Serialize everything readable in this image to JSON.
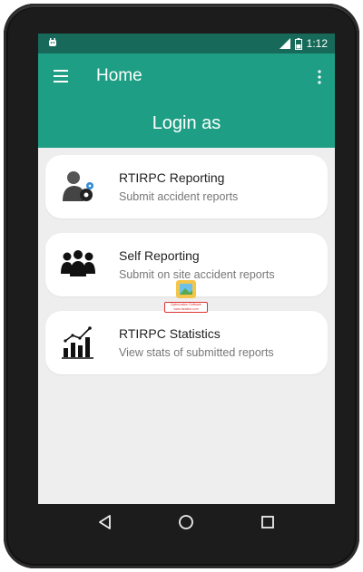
{
  "status_bar": {
    "time": "1:12",
    "left_icon": "android-debug-icon",
    "signal_icon": "signal-icon",
    "battery_icon": "battery-icon",
    "background": "#176a5a"
  },
  "app_bar": {
    "title": "Home",
    "heading": "Login as",
    "menu_icon": "hamburger-menu-icon",
    "overflow_icon": "more-vertical-icon",
    "background": "#1e9e84"
  },
  "cards": [
    {
      "title": "RTIRPC Reporting",
      "subtitle": "Submit accident reports",
      "icon": "user-gear-icon"
    },
    {
      "title": "Self Reporting",
      "subtitle": "Submit on site accident reports",
      "icon": "group-people-icon"
    },
    {
      "title": "RTIRPC Statistics",
      "subtitle": "View stats of submitted reports",
      "icon": "bar-chart-trend-icon"
    }
  ],
  "watermark": {
    "line1": "Optimization Software",
    "line2": "www.fanlabs.com"
  },
  "nav_bar": {
    "back_icon": "back-triangle-icon",
    "home_icon": "home-circle-icon",
    "recent_icon": "recent-square-icon"
  },
  "colors": {
    "accent": "#1e9e84",
    "screen_background": "#eeeeee",
    "card_background": "#ffffff"
  }
}
